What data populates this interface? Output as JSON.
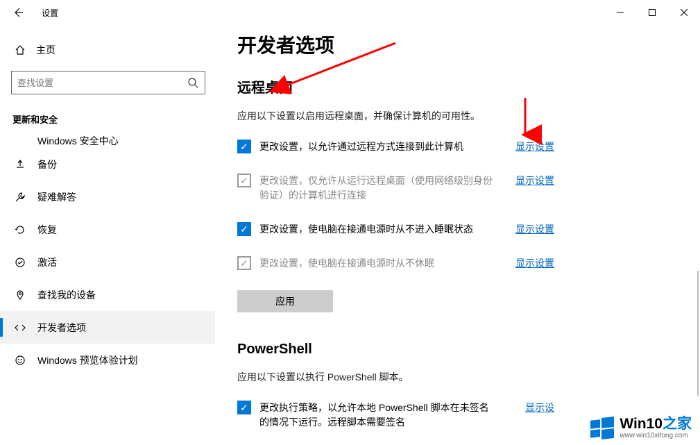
{
  "titlebar": {
    "app_name": "设置"
  },
  "sidebar": {
    "home": "主页",
    "search_placeholder": "查找设置",
    "category": "更新和安全",
    "items": [
      {
        "label": "Windows 安全中心",
        "icon": "shield"
      },
      {
        "label": "备份",
        "icon": "backup"
      },
      {
        "label": "疑难解答",
        "icon": "troubleshoot"
      },
      {
        "label": "恢复",
        "icon": "recovery"
      },
      {
        "label": "激活",
        "icon": "activation"
      },
      {
        "label": "查找我的设备",
        "icon": "findmydevice"
      },
      {
        "label": "开发者选项",
        "icon": "developer"
      },
      {
        "label": "Windows 预览体验计划",
        "icon": "insider"
      }
    ]
  },
  "main": {
    "title": "开发者选项",
    "remote": {
      "heading": "远程桌面",
      "desc": "应用以下设置以启用远程桌面，并确保计算机的可用性。",
      "opts": [
        {
          "label": "更改设置，以允许通过远程方式连接到此计算机",
          "link": "显示设置",
          "checked": true,
          "disabled": false
        },
        {
          "label": "更改设置，仅允许从运行远程桌面（使用网络级别身份验证）的计算机进行连接",
          "link": "显示设置",
          "checked": true,
          "disabled": true
        },
        {
          "label": "更改设置，使电脑在接通电源时从不进入睡眠状态",
          "link": "显示设置",
          "checked": true,
          "disabled": false
        },
        {
          "label": "更改设置，使电脑在接通电源时从不休眠",
          "link": "显示设置",
          "checked": true,
          "disabled": true
        }
      ],
      "apply": "应用"
    },
    "powershell": {
      "heading": "PowerShell",
      "desc": "应用以下设置以执行 PowerShell 脚本。",
      "opts": [
        {
          "label": "更改执行策略，以允许本地 PowerShell 脚本在未签名的情况下运行。远程脚本需要签名",
          "link": "显示设",
          "checked": true,
          "disabled": false
        }
      ]
    }
  },
  "watermark": {
    "brand_a": "Win10",
    "brand_b": "之家",
    "url": "www.win10xitong.com"
  }
}
